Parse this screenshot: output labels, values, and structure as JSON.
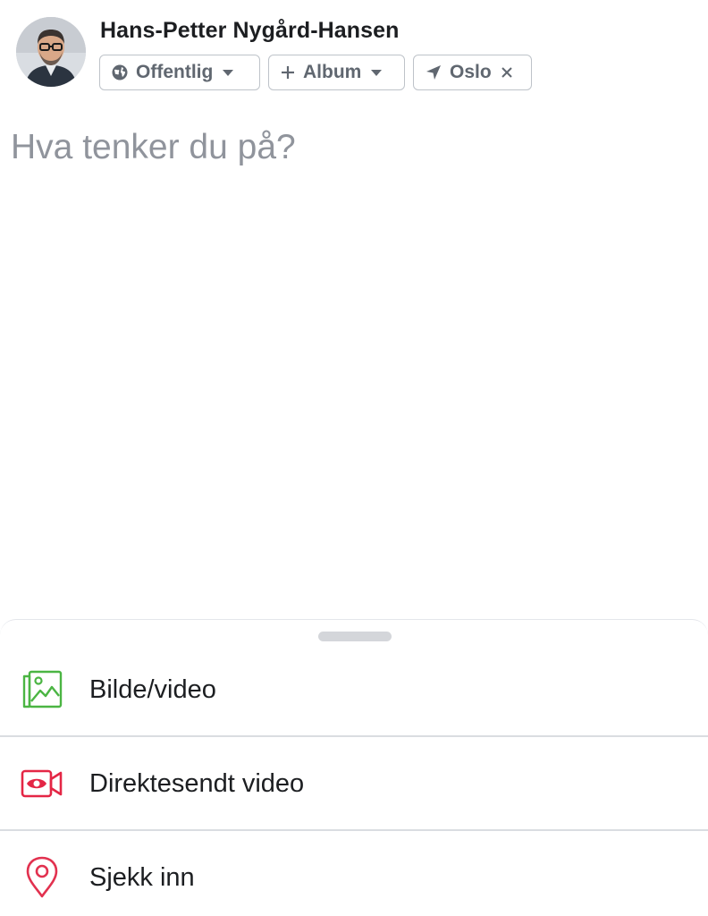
{
  "user": {
    "name": "Hans-Petter Nygård-Hansen"
  },
  "chips": {
    "privacy": {
      "label": "Offentlig",
      "icon": "globe-icon"
    },
    "album": {
      "label": "Album",
      "icon": "plus-icon"
    },
    "location": {
      "label": "Oslo",
      "icon": "location-arrow-icon"
    }
  },
  "composer": {
    "placeholder": "Hva tenker du på?"
  },
  "actions": [
    {
      "label": "Bilde/video",
      "icon": "photo-gallery-icon",
      "color": "#4bb543"
    },
    {
      "label": "Direktesendt video",
      "icon": "live-video-icon",
      "color": "#e42645"
    },
    {
      "label": "Sjekk inn",
      "icon": "location-pin-icon",
      "color": "#e2314f"
    }
  ],
  "colors": {
    "text": "#1c1e21",
    "muted": "#606770",
    "placeholder": "#90949c",
    "border": "#bec3c9"
  }
}
